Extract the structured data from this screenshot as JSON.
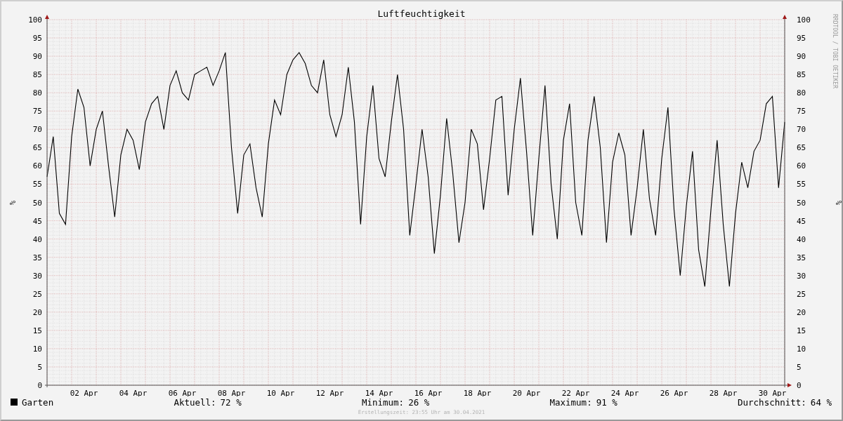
{
  "chart_data": {
    "type": "line",
    "title": "Luftfeuchtigkeit",
    "ylabel": "%",
    "ylim": [
      0,
      100
    ],
    "grid": true,
    "yticks": [
      0,
      5,
      10,
      15,
      20,
      25,
      30,
      35,
      40,
      45,
      50,
      55,
      60,
      65,
      70,
      75,
      80,
      85,
      90,
      95,
      100
    ],
    "categories": [
      null,
      null,
      null,
      null,
      null,
      null,
      "02 Apr",
      null,
      null,
      null,
      null,
      null,
      null,
      null,
      "04 Apr",
      null,
      null,
      null,
      null,
      null,
      null,
      null,
      "06 Apr",
      null,
      null,
      null,
      null,
      null,
      null,
      null,
      "08 Apr",
      null,
      null,
      null,
      null,
      null,
      null,
      null,
      "10 Apr",
      null,
      null,
      null,
      null,
      null,
      null,
      null,
      "12 Apr",
      null,
      null,
      null,
      null,
      null,
      null,
      null,
      "14 Apr",
      null,
      null,
      null,
      null,
      null,
      null,
      null,
      "16 Apr",
      null,
      null,
      null,
      null,
      null,
      null,
      null,
      "18 Apr",
      null,
      null,
      null,
      null,
      null,
      null,
      null,
      "20 Apr",
      null,
      null,
      null,
      null,
      null,
      null,
      null,
      "22 Apr",
      null,
      null,
      null,
      null,
      null,
      null,
      null,
      "24 Apr",
      null,
      null,
      null,
      null,
      null,
      null,
      null,
      "26 Apr",
      null,
      null,
      null,
      null,
      null,
      null,
      null,
      "28 Apr",
      null,
      null,
      null,
      null,
      null,
      null,
      null,
      "30 Apr",
      null,
      null
    ],
    "series": [
      {
        "name": "Garten",
        "color": "#000000",
        "values": [
          57,
          68,
          47,
          44,
          68,
          81,
          76,
          60,
          70,
          75,
          60,
          46,
          63,
          70,
          67,
          59,
          72,
          77,
          79,
          70,
          82,
          86,
          80,
          78,
          85,
          86,
          87,
          82,
          86,
          91,
          65,
          47,
          63,
          66,
          54,
          46,
          66,
          78,
          74,
          85,
          89,
          91,
          88,
          82,
          80,
          89,
          74,
          68,
          74,
          87,
          72,
          44,
          68,
          82,
          62,
          57,
          72,
          85,
          70,
          41,
          55,
          70,
          57,
          36,
          52,
          73,
          58,
          39,
          50,
          70,
          66,
          48,
          62,
          78,
          79,
          52,
          70,
          84,
          64,
          41,
          62,
          82,
          55,
          40,
          67,
          77,
          50,
          41,
          67,
          79,
          65,
          39,
          61,
          69,
          63,
          41,
          54,
          70,
          51,
          41,
          62,
          76,
          48,
          30,
          49,
          64,
          37,
          27,
          48,
          67,
          44,
          27,
          47,
          61,
          54,
          64,
          67,
          77,
          79,
          54,
          72
        ]
      }
    ]
  },
  "right_axis": {
    "label": "%",
    "ticks": [
      "100",
      "95",
      "90",
      "85",
      "80",
      "75",
      "70",
      "65",
      "60",
      "55",
      "50",
      "45",
      "40",
      "35",
      "30",
      "25",
      "20",
      "15",
      "10",
      "5",
      "0"
    ]
  },
  "credit": "RRDTOOL / TOBI OETIKER",
  "stats": [
    {
      "label": "Aktuell:",
      "value": "72 %"
    },
    {
      "label": "Minimum:",
      "value": "26 %"
    },
    {
      "label": "Maximum:",
      "value": "91 %"
    },
    {
      "label": "Durchschnitt:",
      "value": "64 %"
    }
  ],
  "footer": "Erstellungszeit: 23:55 Uhr am 30.04.2021"
}
